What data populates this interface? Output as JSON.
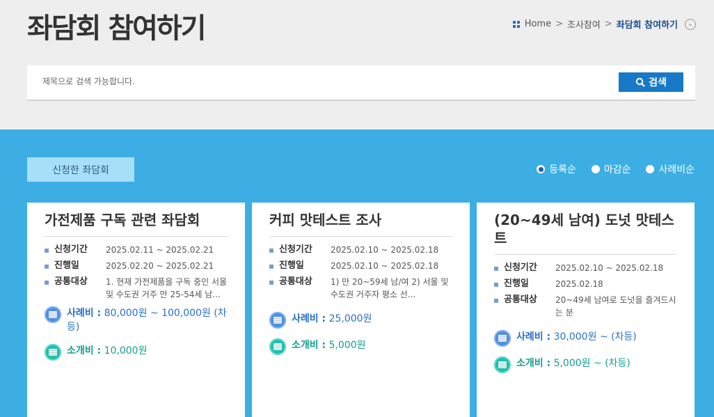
{
  "page_title": "좌담회 참여하기",
  "breadcrumb": {
    "home": "Home",
    "sep1": ">",
    "level1": "조사참여",
    "sep2": ">",
    "current": "좌담회 참여하기",
    "toggle_icon": "chevron-down-icon"
  },
  "search": {
    "placeholder": "제목으로 검색 가능합니다.",
    "button_label": "검색",
    "icon": "search-icon"
  },
  "applied_tab": "신청한 좌담회",
  "sort": {
    "options": [
      "등록순",
      "마감순",
      "사례비순"
    ],
    "selected": "등록순"
  },
  "colors": {
    "main_bg": "#3daee4",
    "button": "#1779c7",
    "fee_blue": "#2a6fc4",
    "fee_teal": "#149e8f"
  },
  "cards": [
    {
      "title": "가전제품 구독 관련 좌담회",
      "apply_label": "신청기간",
      "apply_period": "2025.02.11 ~ 2025.02.21",
      "date_label": "진행일",
      "date": "2025.02.20 ~ 2025.02.21",
      "target_label": "공통대상",
      "target": "1. 현재 가전제품을 구독 중인 서울 및 수도권 거주 만 25-54세 남...",
      "fee_label": "사례비 :",
      "fee": "80,000원 ~ 100,000원 (차등)",
      "referral_label": "소개비 :",
      "referral": "10,000원"
    },
    {
      "title": "커피 맛테스트 조사",
      "apply_label": "신청기간",
      "apply_period": "2025.02.10 ~ 2025.02.18",
      "date_label": "진행일",
      "date": "2025.02.10 ~ 2025.02.18",
      "target_label": "공통대상",
      "target": "1) 만 20~59세 남/여 2) 서울 및 수도권 거주자 평소 선...",
      "fee_label": "사례비 :",
      "fee": "25,000원",
      "referral_label": "소개비 :",
      "referral": "5,000원"
    },
    {
      "title": "(20~49세 남여) 도넛 맛테스트",
      "apply_label": "신청기간",
      "apply_period": "2025.02.10 ~ 2025.02.18",
      "date_label": "진행일",
      "date": "2025.02.18",
      "target_label": "공통대상",
      "target": "20~49세 남여로 도넛을 즐겨드시는 분",
      "fee_label": "사례비 :",
      "fee": "30,000원 ~ (차등)",
      "referral_label": "소개비 :",
      "referral": "5,000원 ~ (차등)"
    }
  ]
}
